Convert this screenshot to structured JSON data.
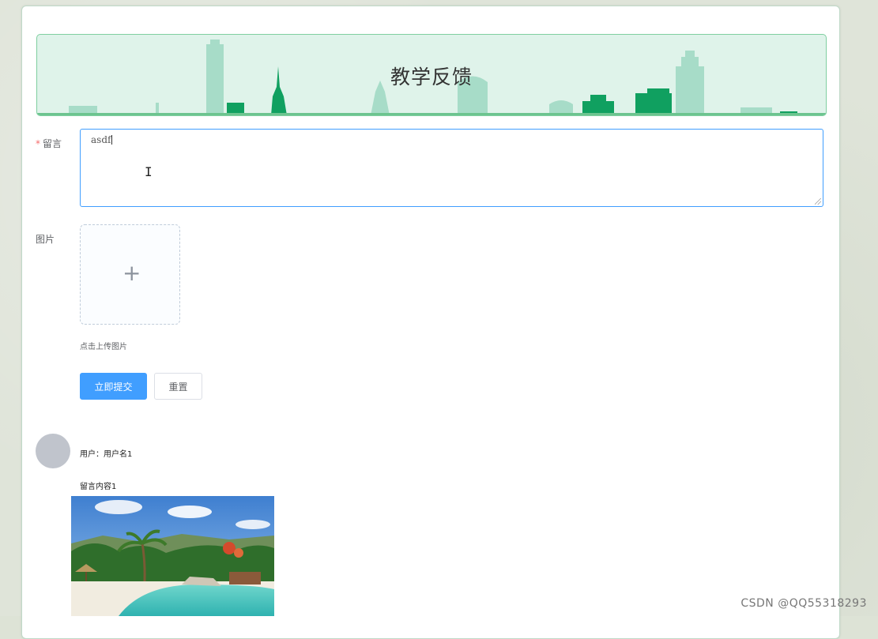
{
  "banner": {
    "title": "教学反馈"
  },
  "form": {
    "message": {
      "required_mark": "*",
      "label": "留言",
      "value": "asdf"
    },
    "image": {
      "label": "图片",
      "hint": "点击上传图片",
      "plus_glyph": "+"
    },
    "submit_label": "立即提交",
    "reset_label": "重置"
  },
  "comment": {
    "user_text": "用户：用户名1",
    "content_text": "留言内容1"
  },
  "watermark": "CSDN @QQ55318293",
  "colors": {
    "primary": "#409eff",
    "banner_bg": "#dff3ea",
    "banner_green": "#10a060",
    "required": "#f56c6c"
  }
}
